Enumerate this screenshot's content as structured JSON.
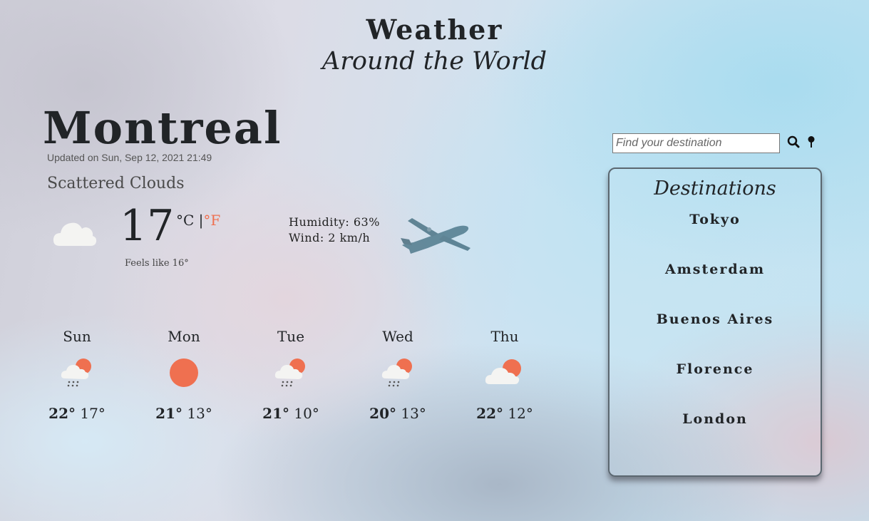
{
  "header": {
    "title": "Weather",
    "subtitle": "Around the World"
  },
  "current": {
    "city": "Montreal",
    "updated": "Updated on Sun, Sep 12, 2021 21:49",
    "description": "Scattered Clouds",
    "icon": "cloud-icon",
    "temperature": "17",
    "unit_c": "°C",
    "unit_sep": "|",
    "unit_f": "°F",
    "feels_like": "Feels like 16°",
    "humidity": "Humidity: 63%",
    "wind": "Wind: 2 km/h"
  },
  "forecast": [
    {
      "day": "Sun",
      "icon": "sun-cloud-rain-icon",
      "max": "22°",
      "min": "17°"
    },
    {
      "day": "Mon",
      "icon": "sun-icon",
      "max": "21°",
      "min": "13°"
    },
    {
      "day": "Tue",
      "icon": "sun-cloud-rain-icon",
      "max": "21°",
      "min": "10°"
    },
    {
      "day": "Wed",
      "icon": "sun-cloud-rain-icon",
      "max": "20°",
      "min": "13°"
    },
    {
      "day": "Thu",
      "icon": "sun-cloud-icon",
      "max": "22°",
      "min": "12°"
    }
  ],
  "search": {
    "placeholder": "Find your destination",
    "value": ""
  },
  "destinations": {
    "title": "Destinations",
    "items": [
      "Tokyo",
      "Amsterdam",
      "Buenos Aires",
      "Florence",
      "London"
    ]
  },
  "colors": {
    "accent": "#ef7050",
    "text": "#212427",
    "cloud": "#f4f4f2"
  }
}
